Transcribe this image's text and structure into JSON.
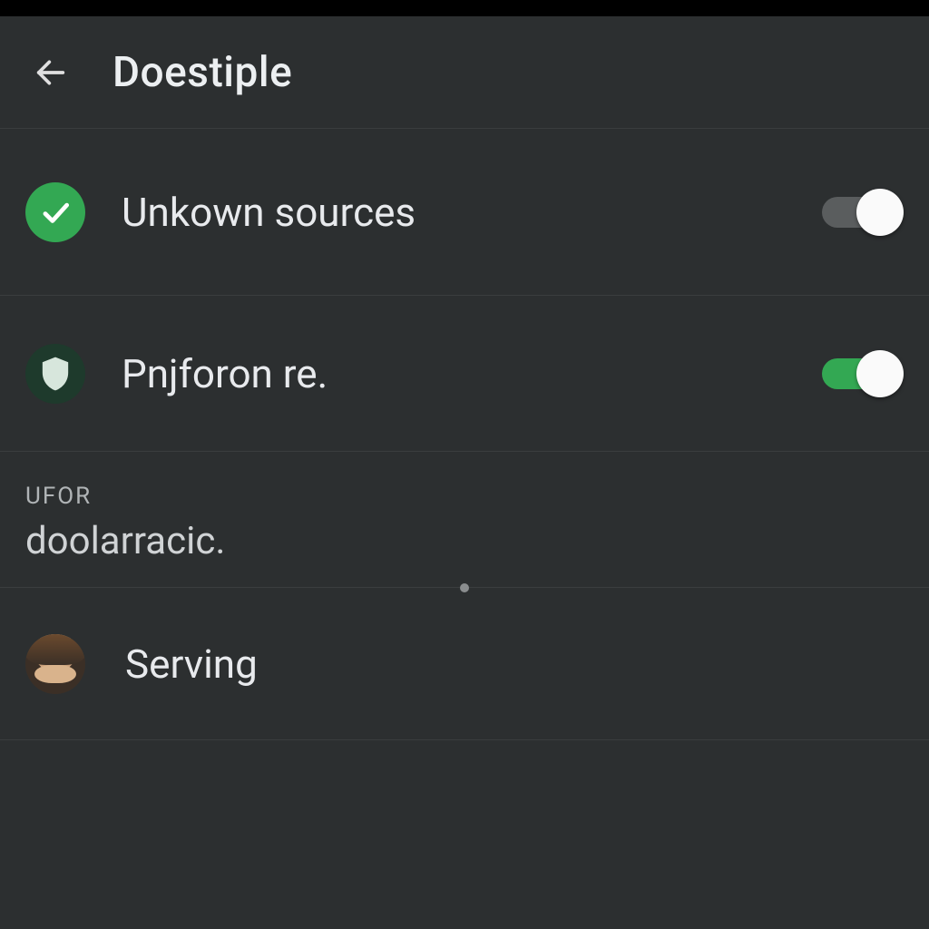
{
  "colors": {
    "accent": "#33a853",
    "bg": "#2c2f30",
    "divider": "#3a3d3e",
    "text": "#e8eaed"
  },
  "header": {
    "title": "Doestiple",
    "back_icon": "arrow-left-icon"
  },
  "rows": [
    {
      "icon": "check-icon",
      "label": "Unkown sources",
      "toggle_on": false
    },
    {
      "icon": "shield-icon",
      "label": "Pnjforon re.",
      "toggle_on": true
    }
  ],
  "section": {
    "header": "UFOR",
    "sub": "doolarracic."
  },
  "serving_row": {
    "label": "Serving"
  }
}
